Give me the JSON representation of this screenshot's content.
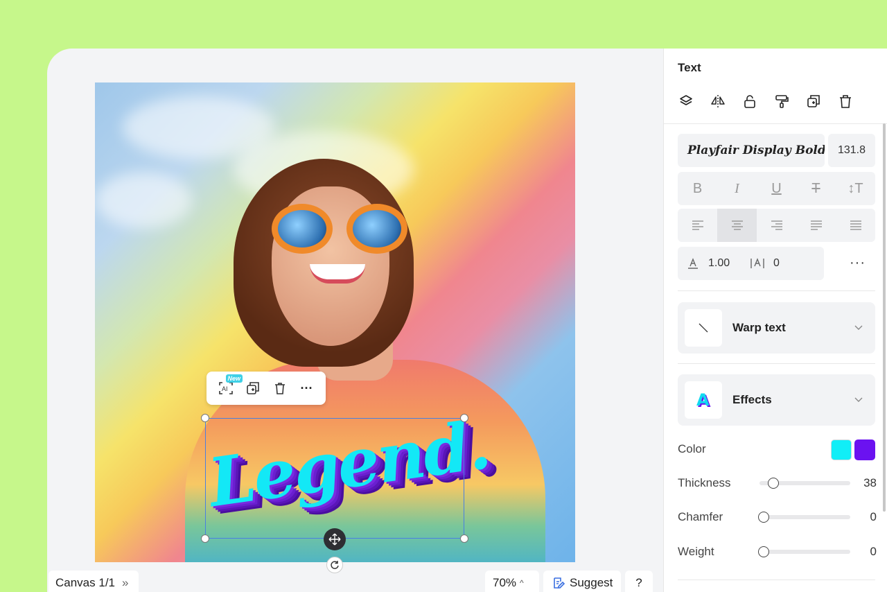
{
  "canvas": {
    "overlay_text": "Legend.",
    "mini_toolbar": {
      "ai_badge": "New",
      "ai_label": "AI",
      "more": "···"
    }
  },
  "bottom_bar": {
    "canvas_label": "Canvas 1/1",
    "canvas_chevron": "»",
    "zoom": "70%",
    "zoom_chevron": "^",
    "suggest": "Suggest",
    "help": "?"
  },
  "panel": {
    "title": "Text",
    "font_name": "Playfair Display BoldI",
    "font_size": "131.8",
    "line_height": "1.00",
    "letter_spacing": "0",
    "more": "···",
    "warp_text": "Warp text",
    "effects": "Effects",
    "color_label": "Color",
    "colors": [
      "#11eef7",
      "#6b12f0"
    ],
    "thickness_label": "Thickness",
    "thickness_value": "38",
    "thickness_level": 0.15,
    "chamfer_label": "Chamfer",
    "chamfer_value": "0",
    "weight_label": "Weight",
    "weight_value": "0"
  }
}
